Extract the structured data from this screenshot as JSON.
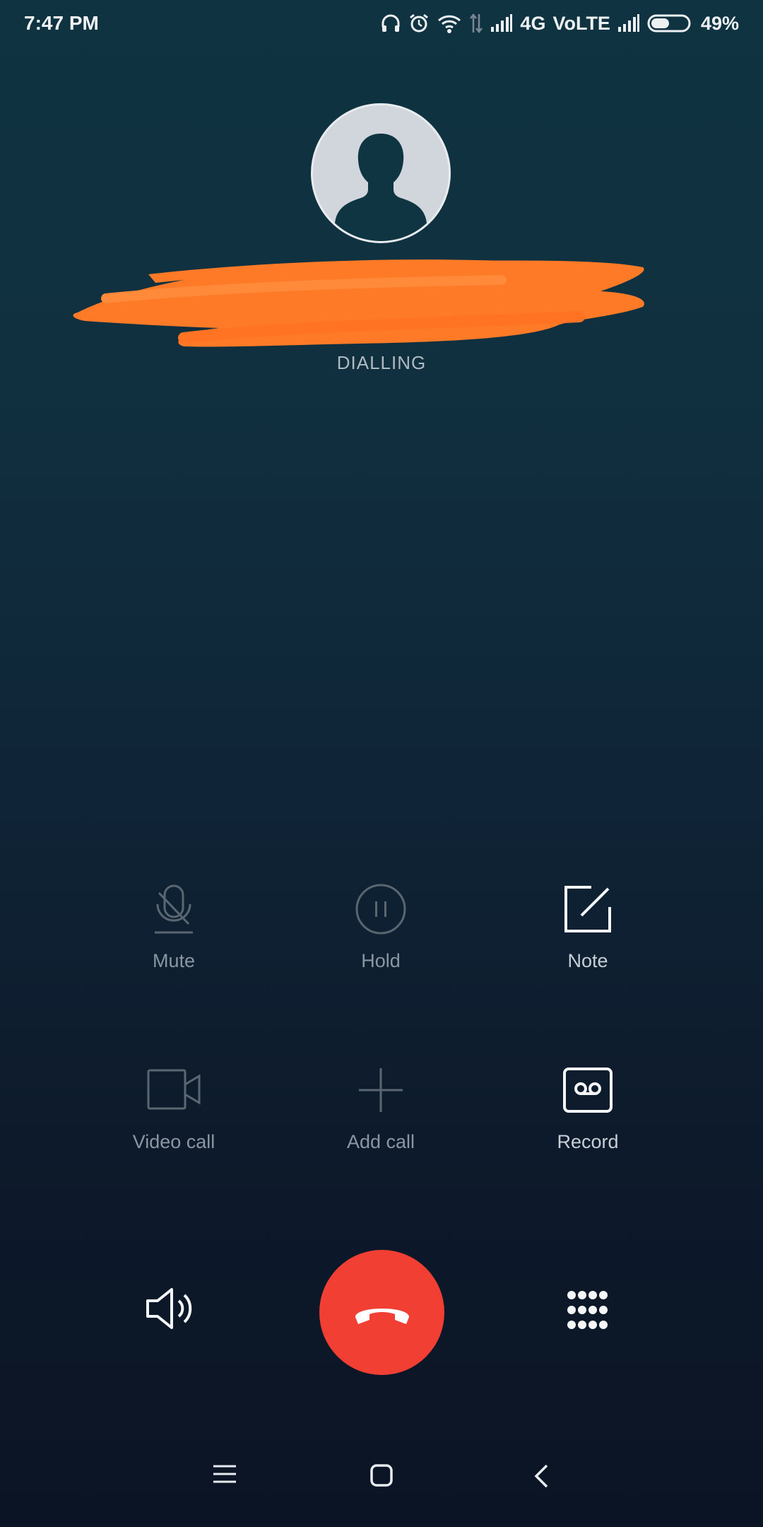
{
  "status_bar": {
    "time": "7:47 PM",
    "network_4g": "4G",
    "volte": "VoLTE",
    "battery_percent": "49%",
    "battery_level": 0.49,
    "icons": [
      "headphones-icon",
      "alarm-icon",
      "wifi-icon",
      "data-transfer-icon",
      "cell-signal-icon",
      "cell-signal-2-icon",
      "battery-icon"
    ]
  },
  "call": {
    "state": "DIALLING",
    "avatar_icon": "default-contact-icon"
  },
  "actions": [
    {
      "label": "Mute",
      "icon": "mute-mic-icon",
      "enabled": false
    },
    {
      "label": "Hold",
      "icon": "pause-icon",
      "enabled": false
    },
    {
      "label": "Note",
      "icon": "note-icon",
      "enabled": true
    },
    {
      "label": "Video call",
      "icon": "video-camera-icon",
      "enabled": false
    },
    {
      "label": "Add call",
      "icon": "plus-icon",
      "enabled": false
    },
    {
      "label": "Record",
      "icon": "record-icon",
      "enabled": true
    }
  ],
  "bottom_controls": {
    "speaker_icon": "speaker-icon",
    "end_call_icon": "hang-up-icon",
    "dialpad_icon": "dialpad-icon",
    "end_call_color": "#f13f33"
  },
  "nav": {
    "icons": [
      "menu-icon",
      "home-icon",
      "back-icon"
    ]
  },
  "colors": {
    "redaction": "#ff7a27",
    "dim_text": "#8a96a1",
    "bright_text": "#c7ced5"
  }
}
